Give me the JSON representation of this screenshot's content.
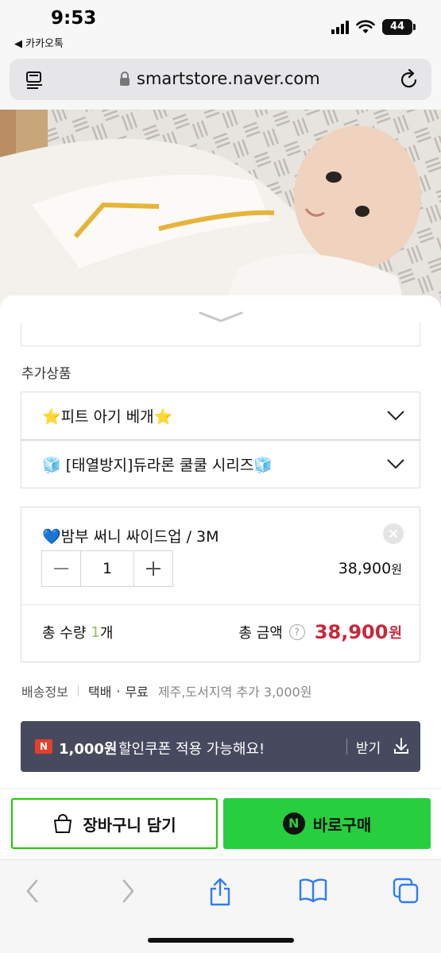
{
  "status_bar": {
    "time": "9:53",
    "back_app": "◀ 카카오톡",
    "battery": "44"
  },
  "browser": {
    "url": "smartstore.naver.com",
    "toolbar_icons": [
      "back-icon",
      "forward-icon",
      "share-icon",
      "bookmarks-icon",
      "tabs-icon"
    ]
  },
  "sheet": {
    "section_label": "추가상품",
    "addons": [
      {
        "label": "⭐피트 아기 베개⭐"
      },
      {
        "label": "🧊 [태열방지]듀라론 쿨쿨 시리즈🧊"
      }
    ],
    "selected_option": {
      "name": "💙밤부 써니 싸이드업 / 3M",
      "quantity": "1",
      "price": "38,900",
      "price_unit": "원"
    },
    "total": {
      "qty_label": "총 수량",
      "qty": "1",
      "qty_unit": "개",
      "amount_label": "총 금액",
      "help": "?",
      "amount": "38,900",
      "amount_unit": "원"
    },
    "shipping": {
      "label": "배송정보",
      "method": "택배",
      "dot": "·",
      "fee": "무료",
      "extra": "제주,도서지역 추가 3,000원"
    },
    "coupon": {
      "badge": "N",
      "amount": "1,000원",
      "message": "할인쿠폰 적용 가능해요!",
      "receive": "받기"
    }
  },
  "purchase": {
    "cart_label": "장바구니 담기",
    "buy_logo": "N",
    "buy_label": "바로구매"
  },
  "colors": {
    "naver_green": "#27cf3e",
    "price_red": "#c8283c",
    "coupon_bg": "#474a5e"
  }
}
